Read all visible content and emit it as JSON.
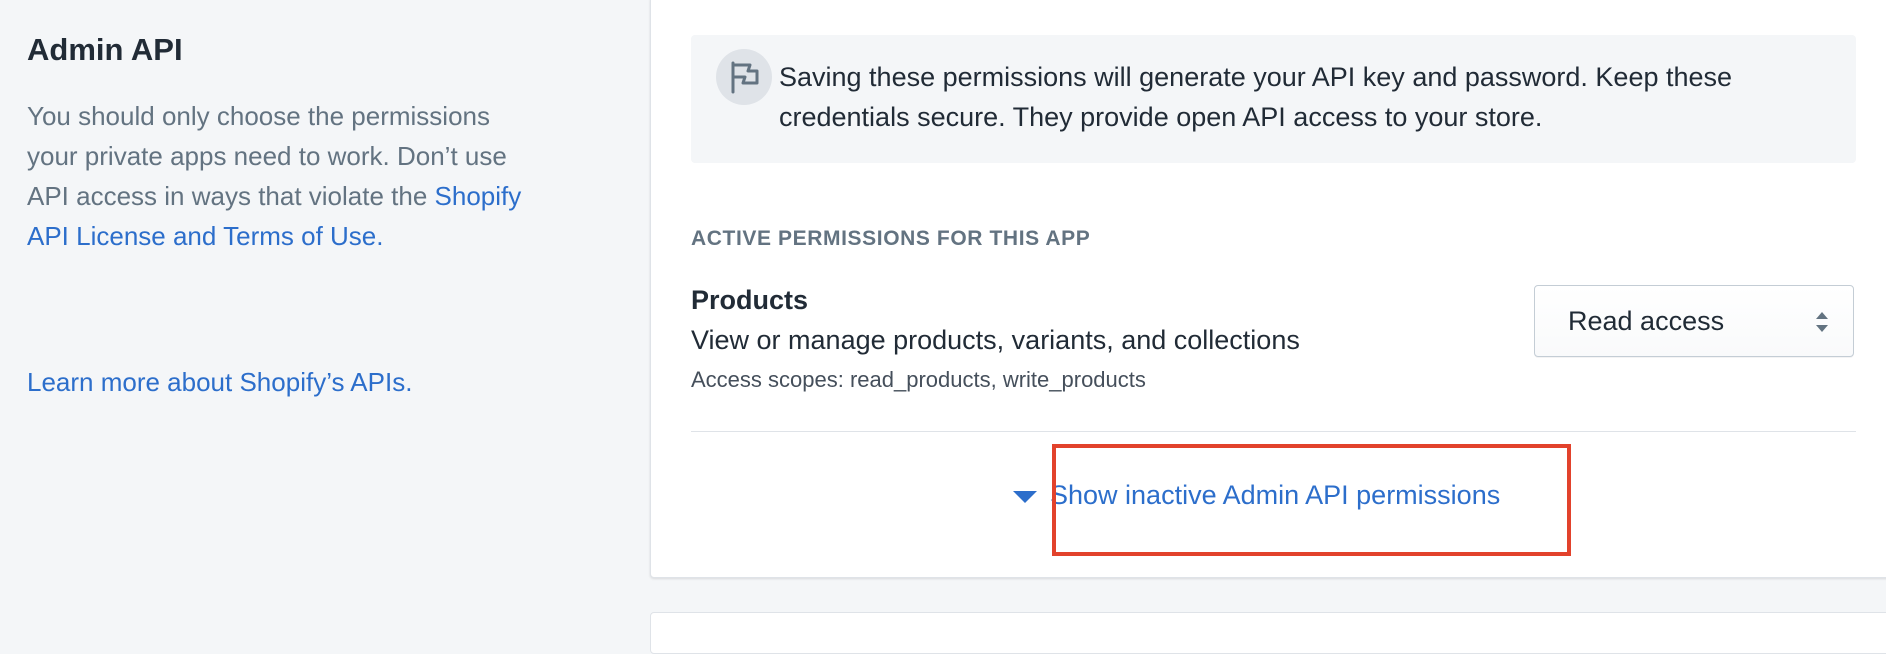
{
  "sidebar": {
    "title": "Admin API",
    "description_pre": "You should only choose the permissions your private apps need to work. Don’t use API access in ways that violate the ",
    "license_link": "Shopify API License and Terms of Use",
    "description_post": ".",
    "learn_more": "Learn more about Shopify’s APIs."
  },
  "banner": {
    "icon": "flag-icon",
    "text": "Saving these permissions will generate your API key and password. Keep these credentials secure. They provide open API access to your store."
  },
  "permissions": {
    "heading": "ACTIVE PERMISSIONS FOR THIS APP",
    "items": [
      {
        "name": "Products",
        "description": "View or manage products, variants, and collections",
        "scopes": "Access scopes: read_products, write_products",
        "access": "Read access"
      }
    ],
    "show_inactive_label": "Show inactive Admin API permissions"
  },
  "colors": {
    "link": "#2c6ecb",
    "highlight": "#e2422c",
    "background": "#f4f6f8"
  }
}
